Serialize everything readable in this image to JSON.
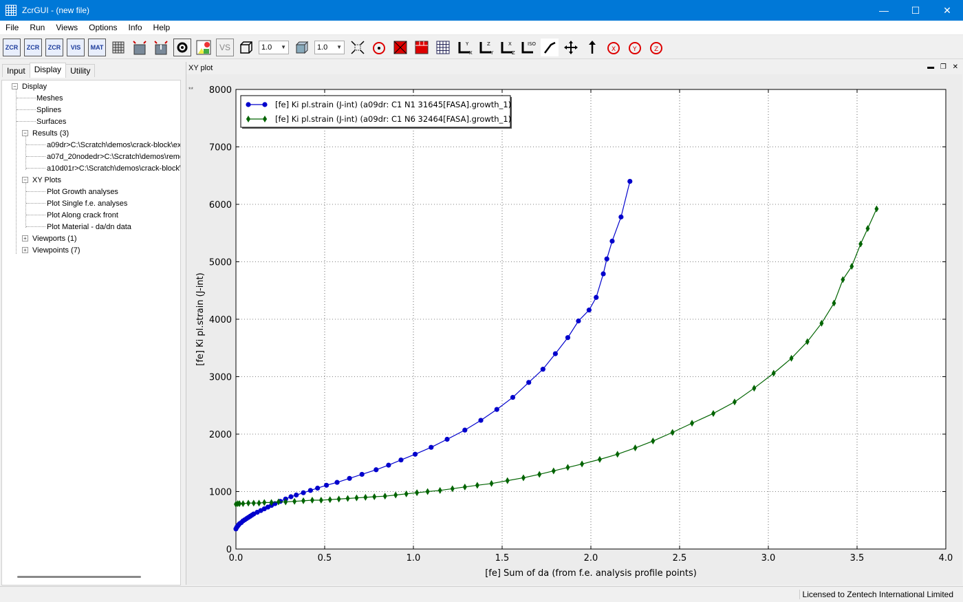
{
  "window": {
    "title": "ZcrGUI - (new file)",
    "controls": [
      "—",
      "☐",
      "✕"
    ]
  },
  "menu": [
    "File",
    "Run",
    "Views",
    "Options",
    "Info",
    "Help"
  ],
  "toolbar": {
    "buttons_left": [
      {
        "label": "ZCR",
        "icon": "zcr-new-icon"
      },
      {
        "label": "ZCR",
        "icon": "zcr-open-icon"
      },
      {
        "label": "ZCR",
        "icon": "zcr-edit-icon"
      },
      {
        "label": "VIS",
        "icon": "vis-icon"
      },
      {
        "label": "MAT",
        "icon": "mat-icon"
      }
    ],
    "combo1_value": "1.0",
    "combo2_value": "1.0",
    "vs_label": "VS",
    "iso_label": "ISO"
  },
  "left_panel": {
    "tabs": [
      "Input",
      "Display",
      "Utility"
    ],
    "active_tab": "Display",
    "tree": [
      {
        "label": "Display",
        "level": 0,
        "expander": "−"
      },
      {
        "label": "Meshes",
        "level": 1
      },
      {
        "label": "Splines",
        "level": 1
      },
      {
        "label": "Surfaces",
        "level": 1
      },
      {
        "label": "Results (3)",
        "level": 1,
        "expander": "−"
      },
      {
        "label": "a09dr>C:\\Scratch\\demos\\crack-block\\ex",
        "level": 2
      },
      {
        "label": "a07d_20nodedr>C:\\Scratch\\demos\\reme",
        "level": 2
      },
      {
        "label": "a10d01r>C:\\Scratch\\demos\\crack-block\\",
        "level": 2
      },
      {
        "label": "XY Plots",
        "level": 1,
        "expander": "−"
      },
      {
        "label": "Plot Growth analyses",
        "level": 2
      },
      {
        "label": "Plot Single f.e. analyses",
        "level": 2
      },
      {
        "label": "Plot Along crack front",
        "level": 2
      },
      {
        "label": "Plot Material - da/dn data",
        "level": 2
      },
      {
        "label": "Viewports (1)",
        "level": 1,
        "expander": "+"
      },
      {
        "label": "Viewpoints (7)",
        "level": 1,
        "expander": "+"
      }
    ]
  },
  "plot_panel": {
    "title": "XY plot",
    "marker": "**"
  },
  "status": {
    "text": "Licensed to Zentech International Limited"
  },
  "chart_data": {
    "type": "line",
    "xlabel": "[fe] Sum of da (from f.e. analysis profile points)",
    "ylabel": "[fe] Ki pl.strain (J-int)",
    "xlim": [
      0.0,
      4.0
    ],
    "ylim": [
      0,
      8000
    ],
    "xticks": [
      "0.0",
      "0.5",
      "1.0",
      "1.5",
      "2.0",
      "2.5",
      "3.0",
      "3.5",
      "4.0"
    ],
    "yticks": [
      "0",
      "1000",
      "2000",
      "3000",
      "4000",
      "5000",
      "6000",
      "7000",
      "8000"
    ],
    "grid": true,
    "legend_position": "top-left",
    "series": [
      {
        "name": "[fe] Ki pl.strain (J-int) (a09dr: C1 N1 31645[FASA].growth_1)",
        "color": "#0000cc",
        "marker": "circle",
        "x": [
          0.0,
          0.005,
          0.01,
          0.015,
          0.02,
          0.03,
          0.04,
          0.05,
          0.06,
          0.07,
          0.08,
          0.09,
          0.1,
          0.12,
          0.14,
          0.16,
          0.18,
          0.2,
          0.22,
          0.25,
          0.28,
          0.31,
          0.34,
          0.38,
          0.42,
          0.46,
          0.51,
          0.57,
          0.64,
          0.71,
          0.79,
          0.86,
          0.93,
          1.01,
          1.1,
          1.19,
          1.29,
          1.38,
          1.47,
          1.56,
          1.65,
          1.73,
          1.8,
          1.87,
          1.93,
          1.99,
          2.03,
          2.07,
          2.09,
          2.12,
          2.17,
          2.22
        ],
        "y": [
          350,
          380,
          400,
          420,
          440,
          460,
          490,
          510,
          530,
          550,
          570,
          590,
          610,
          640,
          670,
          700,
          730,
          760,
          790,
          830,
          870,
          910,
          940,
          980,
          1020,
          1060,
          1110,
          1160,
          1230,
          1300,
          1380,
          1460,
          1550,
          1650,
          1770,
          1910,
          2070,
          2240,
          2430,
          2640,
          2900,
          3130,
          3400,
          3680,
          3970,
          4160,
          4380,
          4790,
          5050,
          5360,
          5780,
          6400
        ]
      },
      {
        "name": "[fe] Ki pl.strain (J-int) (a09dr: C1 N6 32464[FASA].growth_1)",
        "color": "#006400",
        "marker": "diamond",
        "x": [
          0.0,
          0.01,
          0.02,
          0.04,
          0.07,
          0.1,
          0.13,
          0.16,
          0.2,
          0.24,
          0.28,
          0.33,
          0.38,
          0.43,
          0.48,
          0.53,
          0.58,
          0.63,
          0.68,
          0.73,
          0.78,
          0.84,
          0.9,
          0.96,
          1.02,
          1.08,
          1.15,
          1.22,
          1.29,
          1.36,
          1.44,
          1.53,
          1.62,
          1.71,
          1.79,
          1.87,
          1.95,
          2.05,
          2.15,
          2.25,
          2.35,
          2.46,
          2.57,
          2.69,
          2.81,
          2.92,
          3.03,
          3.13,
          3.22,
          3.3,
          3.37,
          3.42,
          3.47,
          3.52,
          3.56,
          3.61
        ],
        "y": [
          780,
          790,
          790,
          790,
          800,
          800,
          800,
          810,
          810,
          820,
          820,
          830,
          840,
          850,
          850,
          860,
          870,
          880,
          890,
          900,
          910,
          920,
          940,
          960,
          980,
          1000,
          1020,
          1050,
          1080,
          1110,
          1140,
          1190,
          1240,
          1300,
          1360,
          1420,
          1480,
          1560,
          1650,
          1760,
          1880,
          2030,
          2190,
          2360,
          2560,
          2800,
          3060,
          3320,
          3610,
          3930,
          4280,
          4690,
          4920,
          5310,
          5580,
          5920
        ]
      }
    ]
  }
}
